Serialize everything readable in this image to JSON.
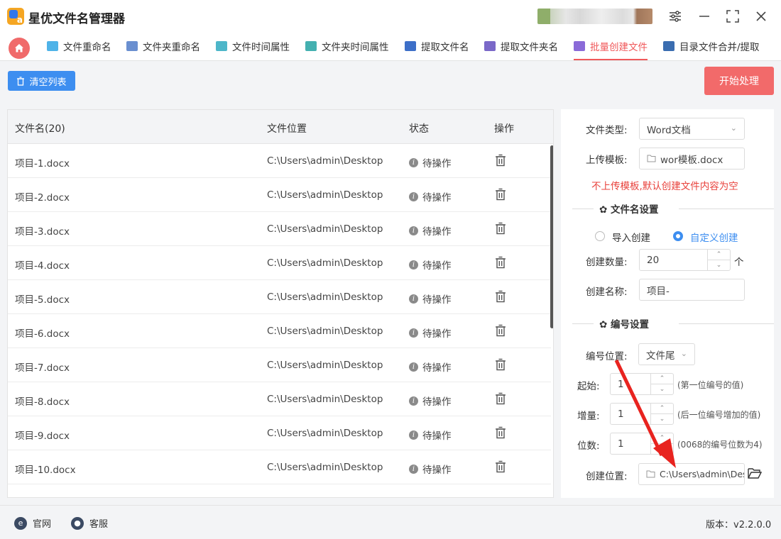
{
  "app": {
    "title": "星优文件名管理器"
  },
  "window_controls": [
    "settings-icon",
    "minimize-icon",
    "maximize-icon",
    "close-icon"
  ],
  "tabs": [
    {
      "label": "文件重命名",
      "icon": "file-rename-icon",
      "color": "#4fb3e8"
    },
    {
      "label": "文件夹重命名",
      "icon": "folder-rename-icon",
      "color": "#6a8fd0"
    },
    {
      "label": "文件时间属性",
      "icon": "file-time-icon",
      "color": "#4db6c9"
    },
    {
      "label": "文件夹时间属性",
      "icon": "folder-time-icon",
      "color": "#44b0b0"
    },
    {
      "label": "提取文件名",
      "icon": "extract-filename-icon",
      "color": "#3d6fc8"
    },
    {
      "label": "提取文件夹名",
      "icon": "extract-foldername-icon",
      "color": "#7a68c8"
    },
    {
      "label": "批量创建文件",
      "icon": "batch-create-icon",
      "color": "#8a6ad8",
      "active": true
    },
    {
      "label": "目录文件合并/提取",
      "icon": "merge-extract-icon",
      "color": "#3a6db0"
    }
  ],
  "toolbar": {
    "clear_label": "清空列表",
    "start_label": "开始处理"
  },
  "table": {
    "headers": [
      "文件名(20)",
      "文件位置",
      "状态",
      "操作"
    ],
    "rows": [
      {
        "name": "项目-1.docx",
        "path": "C:\\Users\\admin\\Desktop",
        "status": "待操作"
      },
      {
        "name": "项目-2.docx",
        "path": "C:\\Users\\admin\\Desktop",
        "status": "待操作"
      },
      {
        "name": "项目-3.docx",
        "path": "C:\\Users\\admin\\Desktop",
        "status": "待操作"
      },
      {
        "name": "项目-4.docx",
        "path": "C:\\Users\\admin\\Desktop",
        "status": "待操作"
      },
      {
        "name": "项目-5.docx",
        "path": "C:\\Users\\admin\\Desktop",
        "status": "待操作"
      },
      {
        "name": "项目-6.docx",
        "path": "C:\\Users\\admin\\Desktop",
        "status": "待操作"
      },
      {
        "name": "项目-7.docx",
        "path": "C:\\Users\\admin\\Desktop",
        "status": "待操作"
      },
      {
        "name": "项目-8.docx",
        "path": "C:\\Users\\admin\\Desktop",
        "status": "待操作"
      },
      {
        "name": "项目-9.docx",
        "path": "C:\\Users\\admin\\Desktop",
        "status": "待操作"
      },
      {
        "name": "项目-10.docx",
        "path": "C:\\Users\\admin\\Desktop",
        "status": "待操作"
      }
    ]
  },
  "settings": {
    "file_type_label": "文件类型:",
    "file_type_value": "Word文档",
    "template_label": "上传模板:",
    "template_value": "wor模板.docx",
    "template_warning": "不上传模板,默认创建文件内容为空",
    "filename_section": "文件名设置",
    "radio_import": "导入创建",
    "radio_custom": "自定义创建",
    "count_label": "创建数量:",
    "count_value": "20",
    "count_unit": "个",
    "name_label": "创建名称:",
    "name_value": "项目-",
    "numbering_section": "编号设置",
    "pos_label": "编号位置:",
    "pos_value": "文件尾",
    "start_label": "起始:",
    "start_value": "1",
    "start_hint": "(第一位编号的值)",
    "inc_label": "增量:",
    "inc_value": "1",
    "inc_hint": "(后一位编号增加的值)",
    "digits_label": "位数:",
    "digits_value": "1",
    "digits_hint": "(0068的编号位数为4)",
    "location_label": "创建位置:",
    "location_value": "C:\\Users\\admin\\Des"
  },
  "footer": {
    "website": "官网",
    "support": "客服",
    "version": "版本：v2.2.0.0"
  },
  "colors": {
    "accent_red": "#f26a6a",
    "accent_blue": "#3d8ef0",
    "warning_red": "#e8413b",
    "arrow_red": "#e8231f"
  }
}
